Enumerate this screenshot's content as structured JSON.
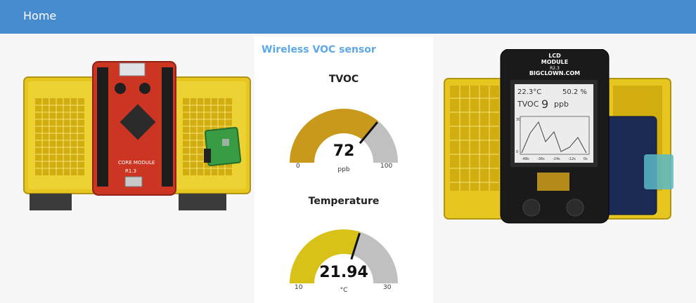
{
  "header": {
    "title": "Home"
  },
  "widget": {
    "title": "Wireless VOC sensor"
  },
  "gauges": [
    {
      "label": "TVOC",
      "value": "72",
      "unit": "ppb",
      "min": "0",
      "max": "100",
      "fill_fraction": 0.72,
      "color": "#c8991a"
    },
    {
      "label": "Temperature",
      "value": "21.94",
      "unit": "°C",
      "min": "10",
      "max": "30",
      "fill_fraction": 0.597,
      "color": "#d9c218"
    }
  ],
  "photos": {
    "left": {
      "board_labels": [
        "CORE MODULE",
        "R1.3"
      ]
    },
    "right": {
      "lcd_header": [
        "LCD",
        "MODULE",
        "R2.3",
        "BIGCLOWN.COM"
      ],
      "screen_temperature": "22.3°C",
      "screen_humidity": "50.2 %",
      "screen_tvoc_label": "TVOC",
      "screen_tvoc_value": "9",
      "screen_tvoc_unit": "ppb",
      "screen_axis": [
        "-48s",
        "-36s",
        "-24s",
        "-12s",
        "0s"
      ],
      "screen_y_labels": [
        "30",
        "0"
      ]
    }
  }
}
